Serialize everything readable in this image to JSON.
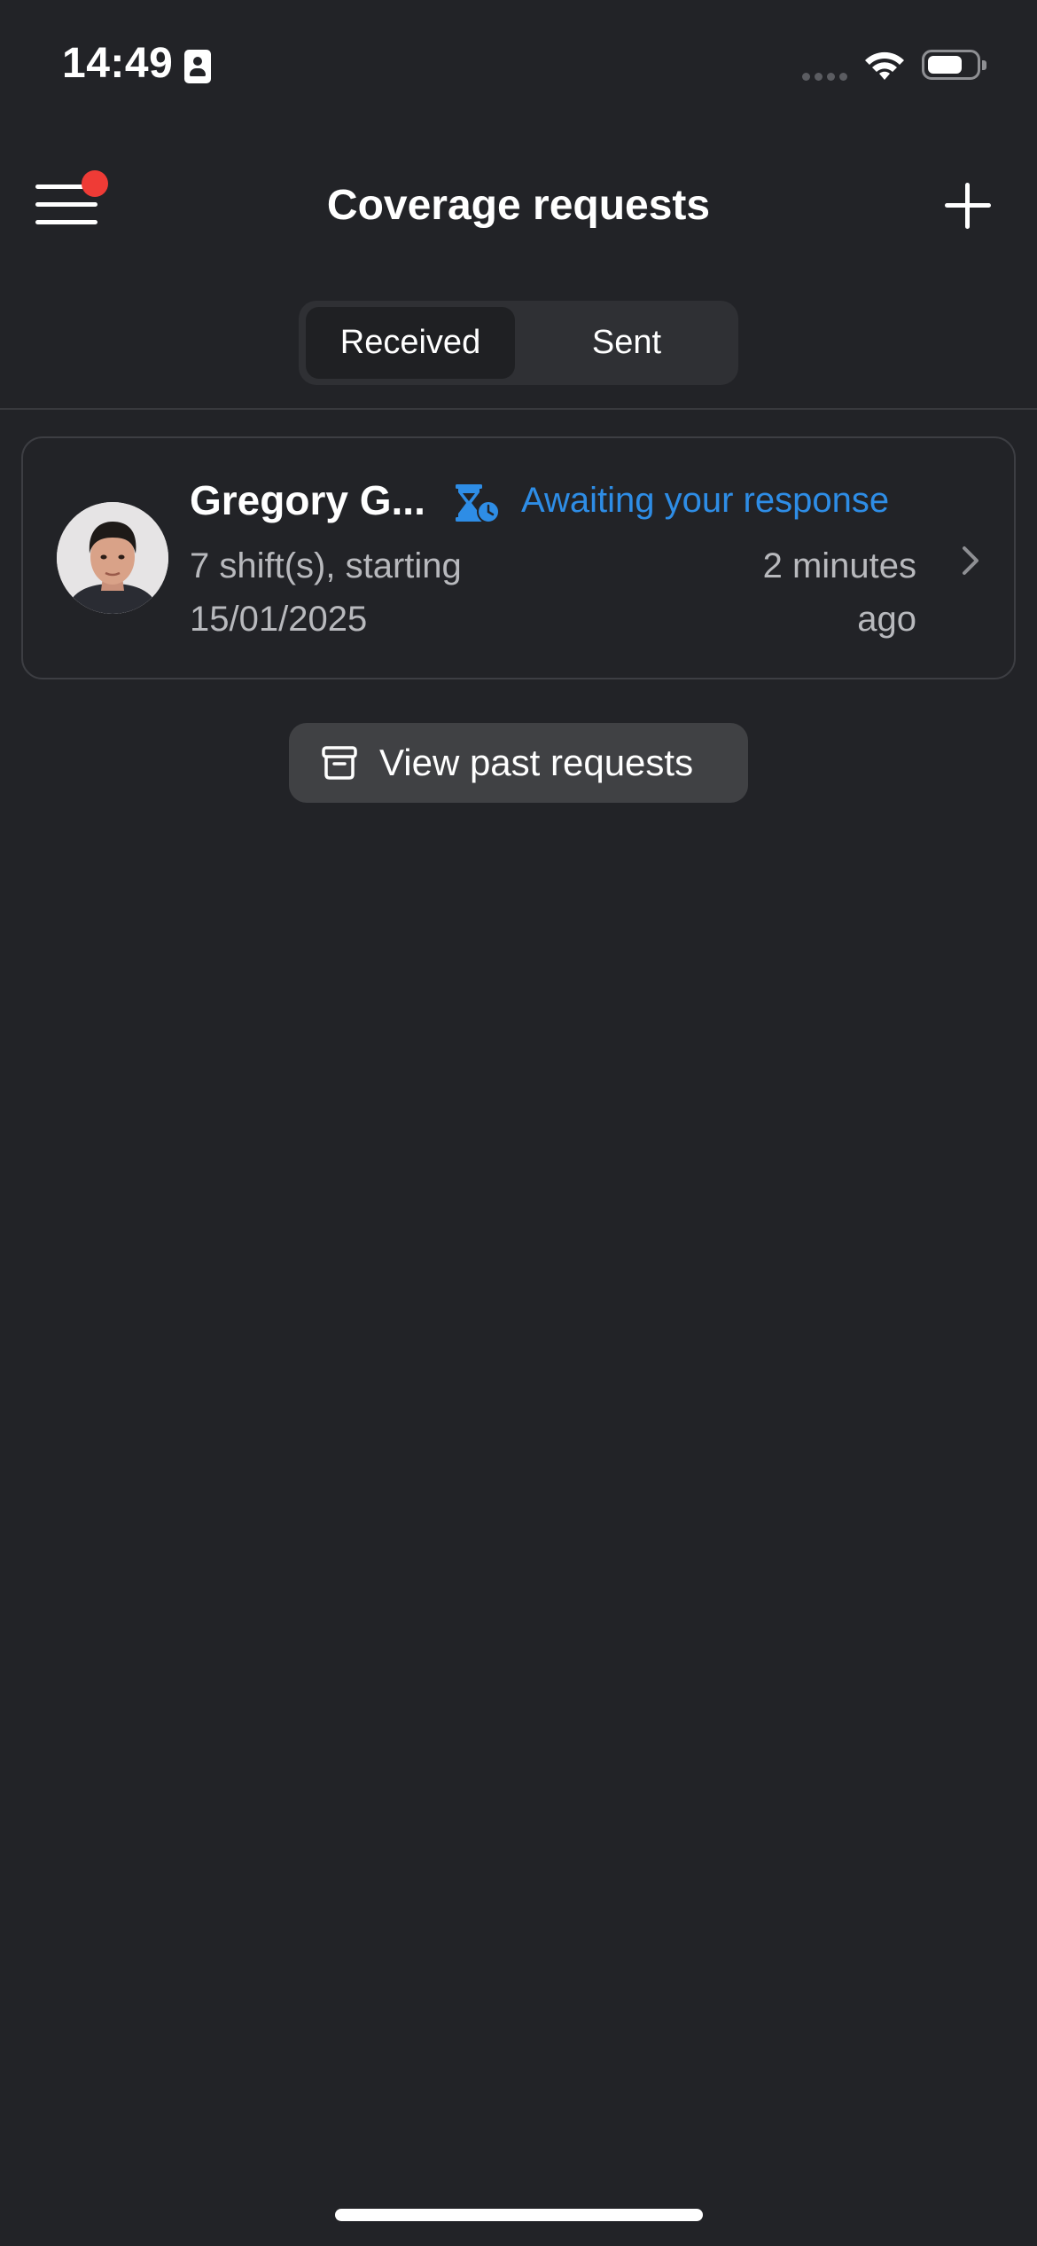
{
  "status_bar": {
    "time": "14:49",
    "icons": [
      "id-card-icon",
      "cellular-signal-icon",
      "wifi-icon",
      "battery-icon"
    ]
  },
  "header": {
    "title": "Coverage requests",
    "menu_icon": "hamburger-menu-icon",
    "menu_badge_color": "#ef3b36",
    "add_icon": "plus-icon"
  },
  "tabs": [
    {
      "label": "Received",
      "selected": true
    },
    {
      "label": "Sent",
      "selected": false
    }
  ],
  "requests": [
    {
      "name": "Gregory G...",
      "status": "Awaiting your response",
      "status_icon": "hourglass-clock-icon",
      "status_color": "#2e8de6",
      "summary": "7 shift(s), starting 15/01/2025",
      "time_ago": "2 minutes ago"
    }
  ],
  "past_button": {
    "label": "View past requests",
    "icon": "archive-box-icon"
  },
  "colors": {
    "background": "#222327",
    "accent": "#2e8de6",
    "muted_text": "#b8b9bd"
  }
}
